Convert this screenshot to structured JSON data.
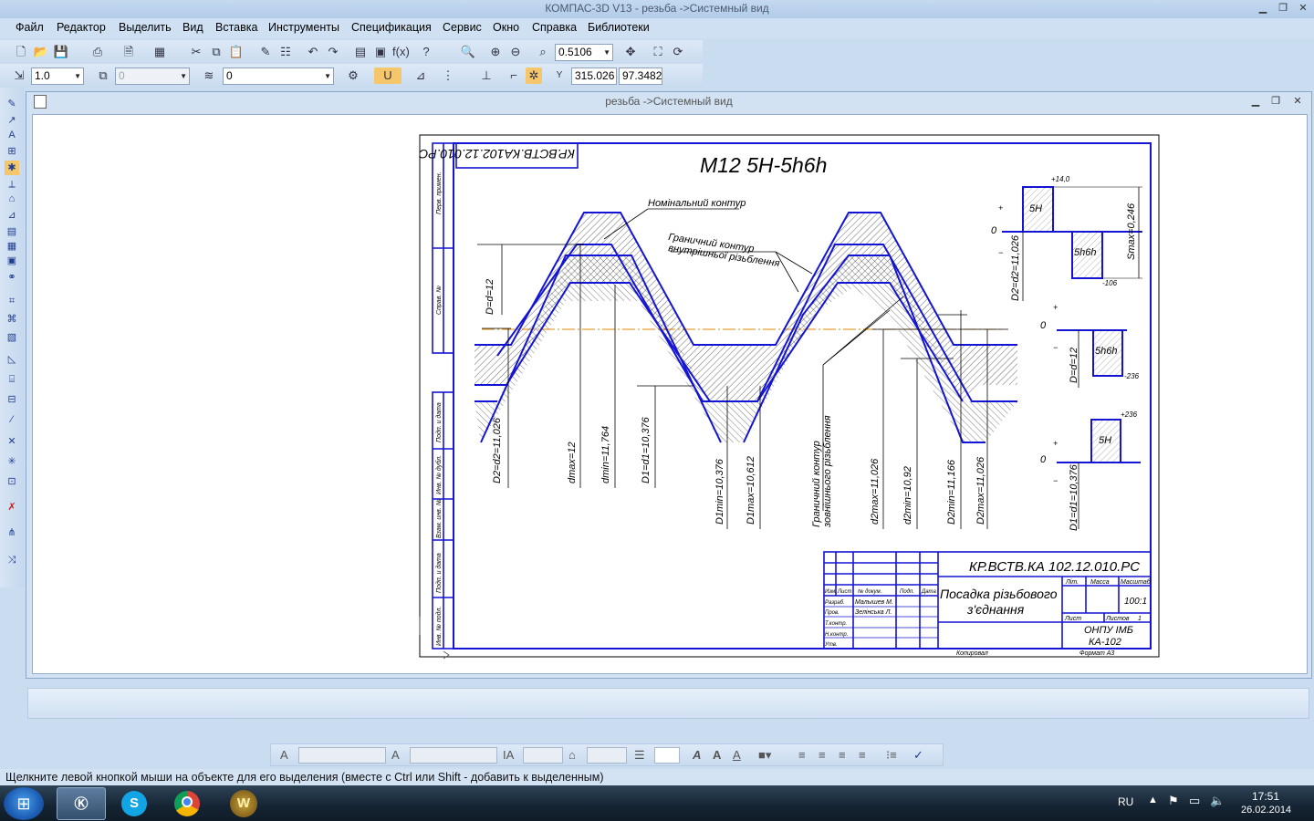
{
  "window": {
    "title": "КОМПАС-3D V13 - резьба ->Системный вид",
    "minimize_icon": "minimize-icon",
    "maximize_icon": "restore-icon",
    "close_icon": "close-icon"
  },
  "menu": [
    "Файл",
    "Редактор",
    "Выделить",
    "Вид",
    "Вставка",
    "Инструменты",
    "Спецификация",
    "Сервис",
    "Окно",
    "Справка",
    "Библиотеки"
  ],
  "toolbar": {
    "zoom_value": "0.5106",
    "step_value": "1.0",
    "layer_value": "0",
    "style_value": "0",
    "disabled_value": "0",
    "coord_x": "315.026",
    "coord_y": "97.3482"
  },
  "document": {
    "title": "резьба ->Системный вид"
  },
  "drawing": {
    "designation_rotated": "КР.ВСТВ.КА102.12.010.РС",
    "thread_title": "M12 5H-5h6h",
    "label_nominal": "Номінальний контур",
    "label_boundary_internal_1": "Граничний контур",
    "label_boundary_internal_2": "внутрішньої різьблення",
    "label_boundary_external_1": "Граничний контур",
    "label_boundary_external_2": "зовнішнього різьблення",
    "dim_D": "D=d=12",
    "dim_D2": "D2=d2=11,026",
    "dim_dmax": "dmax=12",
    "dim_dmin": "dmin=11,764",
    "dim_D1": "D1=d1=10,376",
    "dim_D1min": "D1min=10,376",
    "dim_D1max": "D1max=10,612",
    "dim_d2max": "d2max=11,026",
    "dim_d2min": "d2min=10,92",
    "dim_D2min": "D2min=11,166",
    "dim_D2max": "D2max=11,026",
    "tol_d2": {
      "upper": "+14,0",
      "zero": "0",
      "lower": "-106",
      "label_upper": "5H",
      "label_lower": "5h6h",
      "side": "D2=d2=11,026",
      "smax": "Smax=0,246"
    },
    "tol_d": {
      "zero": "0",
      "label": "5h6h",
      "side": "D=d=12",
      "lower": "-236"
    },
    "tol_D1": {
      "zero": "0",
      "label": "5H",
      "side": "D1=d1=10,376",
      "upper": "+236"
    },
    "plus": "+",
    "minus": "−",
    "stamp_code": "КР.ВСТВ.КА 102.12.010.РС",
    "stamp_name_1": "Посадка різьбового",
    "stamp_name_2": "з'єднання",
    "stamp_lit": "Літ.",
    "stamp_mass": "Масса",
    "stamp_scale": "Масштаб",
    "stamp_scale_value": "100:1",
    "stamp_sheet": "Лист",
    "stamp_sheets": "Листов",
    "stamp_sheets_value": "1",
    "stamp_org_1": "ОНПУ ІМБ",
    "stamp_org_2": "КА-102",
    "stamp_izm": "Изм.",
    "stamp_list": "Лист",
    "stamp_doc": "№ докум.",
    "stamp_sign": "Подп.",
    "stamp_date": "Дата",
    "stamp_razrab": "Разраб.",
    "stamp_razrab_name": "Малышев М.",
    "stamp_prov": "Пров.",
    "stamp_prov_name": "Зелінська Л.",
    "stamp_tkontr": "Т.контр.",
    "stamp_nkontr": "Н.контр.",
    "stamp_utv": "Утв.",
    "stamp_kopiroval": "Копировал",
    "stamp_format": "Формат   A3",
    "side_perv": "Перв. примен.",
    "side_sprav": "Справ. №",
    "side_podp1": "Подп. и дата",
    "side_inv_dubl": "Инв. № дубл.",
    "side_vzam": "Взам. инв. №",
    "side_podp2": "Подп. и дата",
    "side_inv_podl": "Инв. № подл."
  },
  "format_toolbar": {
    "font": "",
    "size": ""
  },
  "status_text": "Щелкните левой кнопкой мыши на объекте для его выделения (вместе с Ctrl или Shift - добавить к выделенным)",
  "taskbar": {
    "lang": "RU",
    "time": "17:51",
    "date": "26.02.2014",
    "apps": [
      "kompas-icon",
      "skype-icon",
      "chrome-icon",
      "warcraft-icon"
    ]
  }
}
